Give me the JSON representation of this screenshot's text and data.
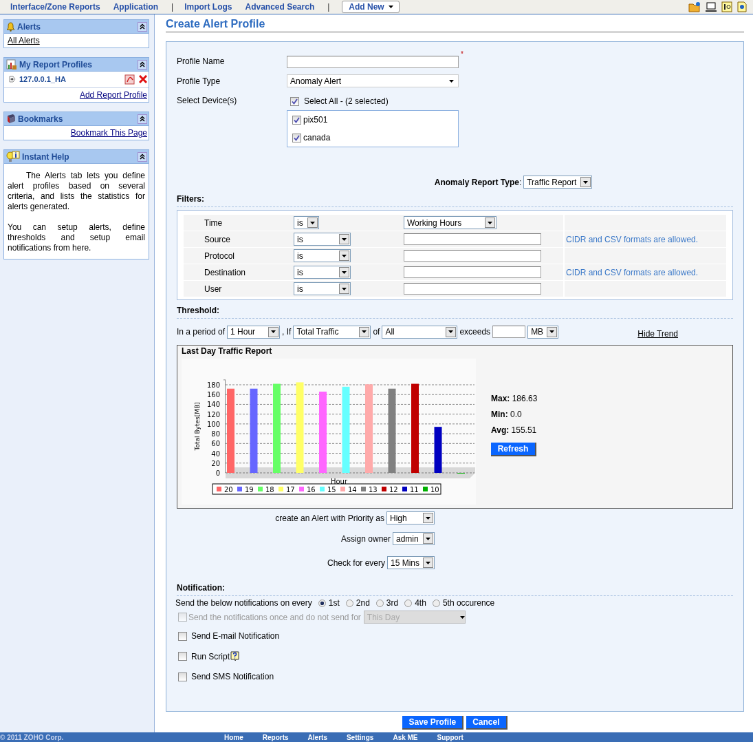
{
  "top_nav": {
    "links": [
      {
        "kind": "link",
        "label": "Interface/Zone Reports"
      },
      {
        "kind": "link",
        "label": "Application"
      },
      {
        "kind": "divider",
        "label": "|"
      },
      {
        "kind": "link",
        "label": "Import Logs"
      },
      {
        "kind": "link",
        "label": "Advanced Search"
      },
      {
        "kind": "divider",
        "label": "|"
      }
    ],
    "add_new": "Add New"
  },
  "sidebar": [
    {
      "kind": "links",
      "title": "Alerts",
      "links": [
        "All Alerts"
      ]
    },
    {
      "kind": "profiles",
      "title": "My Report Profiles",
      "profiles": [
        "127.0.0.1_HA"
      ],
      "link": "Add Report Profile"
    },
    {
      "kind": "links",
      "title": "Bookmarks",
      "links": [
        "Bookmark This Page"
      ]
    },
    {
      "kind": "help",
      "title": "Instant Help",
      "paragraphs": [
        "The Alerts tab lets you define alert profiles based on several criteria, and lists the statistics for alerts generated.",
        "You can setup alerts, define thresholds and setup email notifications from here."
      ]
    }
  ],
  "page_title": "Create Alert Profile",
  "form": {
    "profile_name": {
      "label": "Profile Name",
      "required_mark": "*"
    },
    "profile_type": {
      "label": "Profile Type",
      "value": "Anomaly Alert"
    },
    "devices": {
      "label": "Select Device(s)",
      "select_all": {
        "label": "Select All - (2 selected)",
        "checked": true
      },
      "items": [
        {
          "label": "pix501",
          "checked": true
        },
        {
          "label": "canada",
          "checked": true
        }
      ]
    },
    "anomaly_type": {
      "label": "**Anomaly Report Type**:",
      "value": "Traffic Report"
    }
  },
  "filters": {
    "heading": "Filters:",
    "rows": [
      {
        "label": "Time",
        "operator": "is",
        "kind": "select",
        "value": "Working Hours"
      },
      {
        "label": "Source",
        "operator": "is",
        "kind": "input",
        "note": "CIDR and CSV formats are allowed."
      },
      {
        "label": "Protocol",
        "operator": "is",
        "kind": "input"
      },
      {
        "label": "Destination",
        "operator": "is",
        "kind": "input",
        "note": "CIDR and CSV formats are allowed."
      },
      {
        "label": "User",
        "operator": "is",
        "kind": "input"
      }
    ]
  },
  "threshold": {
    "heading": "Threshold:",
    "period_label": "In a period of",
    "period": "1 Hour",
    "if_label": ", If",
    "metric": "Total Traffic",
    "of_label": "of",
    "scope": "All",
    "exceeds_label": "exceeds",
    "unit": "MB",
    "hide_trend": "Hide Trend"
  },
  "trend": {
    "title": "Last Day Traffic Report",
    "chart_data": {
      "type": "bar",
      "xlabel": "Hour",
      "ylabel": "Total Bytes[MB]",
      "stacked": true,
      "series": [
        {
          "name": "20",
          "color": "#ff6666",
          "values": [
            172,
            null,
            null,
            null,
            null,
            null,
            null,
            null,
            null,
            null,
            null
          ]
        },
        {
          "name": "19",
          "color": "#6666ff",
          "values": [
            null,
            172,
            null,
            null,
            null,
            null,
            null,
            null,
            null,
            null,
            null
          ]
        },
        {
          "name": "18",
          "color": "#66ff66",
          "values": [
            null,
            null,
            182,
            null,
            null,
            null,
            null,
            null,
            null,
            null,
            null
          ]
        },
        {
          "name": "17",
          "color": "#ffff66",
          "values": [
            null,
            null,
            null,
            185,
            null,
            null,
            null,
            null,
            null,
            null,
            null
          ]
        },
        {
          "name": "16",
          "color": "#ff66ff",
          "values": [
            null,
            null,
            null,
            null,
            166,
            null,
            null,
            null,
            null,
            null,
            null
          ]
        },
        {
          "name": "15",
          "color": "#66ffff",
          "values": [
            null,
            null,
            null,
            null,
            null,
            176,
            null,
            null,
            null,
            null,
            null
          ]
        },
        {
          "name": "14",
          "color": "#ffaaaa",
          "values": [
            null,
            null,
            null,
            null,
            null,
            null,
            181,
            null,
            null,
            null,
            null
          ]
        },
        {
          "name": "13",
          "color": "#808080",
          "values": [
            null,
            null,
            null,
            null,
            null,
            null,
            null,
            172,
            null,
            null,
            null
          ]
        },
        {
          "name": "12",
          "color": "#c00000",
          "values": [
            null,
            null,
            null,
            null,
            null,
            null,
            null,
            null,
            182,
            null,
            null
          ]
        },
        {
          "name": "11",
          "color": "#0000c0",
          "values": [
            null,
            null,
            null,
            null,
            null,
            null,
            null,
            null,
            null,
            94,
            null
          ]
        },
        {
          "name": "10",
          "color": "#00b000",
          "values": [
            null,
            null,
            null,
            null,
            null,
            null,
            null,
            null,
            null,
            null,
            0
          ]
        }
      ],
      "ylim": [
        0,
        190
      ],
      "yticks": [
        0,
        20,
        40,
        60,
        80,
        100,
        120,
        140,
        160,
        180
      ],
      "grid": true,
      "legend": "bottom"
    },
    "stats": [
      {
        "label": "Max:",
        "value": "186.63"
      },
      {
        "label": "Min:",
        "value": "0.0"
      },
      {
        "label": "Avg:",
        "value": "155.51"
      }
    ],
    "refresh": "Refresh"
  },
  "alert_settings": [
    {
      "label": "create an Alert with Priority as",
      "value": "High"
    },
    {
      "label": "Assign owner",
      "value": "admin"
    },
    {
      "label": "Check for every",
      "value": "15 Mins"
    }
  ],
  "notification": {
    "heading": "Notification:",
    "every_label": "Send the below notifications on every",
    "occurrences": [
      {
        "label": "1st",
        "selected": true
      },
      {
        "label": "2nd",
        "selected": false
      },
      {
        "label": "3rd",
        "selected": false
      },
      {
        "label": "4th",
        "selected": false
      },
      {
        "label": "5th occurence",
        "selected": false
      }
    ],
    "options": [
      {
        "kind": "suppress",
        "label": "Send the notifications once and do not send for",
        "checked": false,
        "disabled": true,
        "value": "This Day"
      },
      {
        "kind": "plain",
        "label": "Send E-mail Notification",
        "checked": false,
        "disabled": false
      },
      {
        "kind": "help",
        "label": "Run Script",
        "checked": false,
        "disabled": false
      },
      {
        "kind": "plain",
        "label": "Send SMS Notification",
        "checked": false,
        "disabled": false
      }
    ]
  },
  "buttons": [
    "Save Profile",
    "Cancel"
  ],
  "footer": {
    "copyright": "© 2011 ZOHO Corp.",
    "links": [
      "Home",
      "Reports",
      "Alerts",
      "Settings",
      "Ask ME",
      "Support"
    ]
  }
}
